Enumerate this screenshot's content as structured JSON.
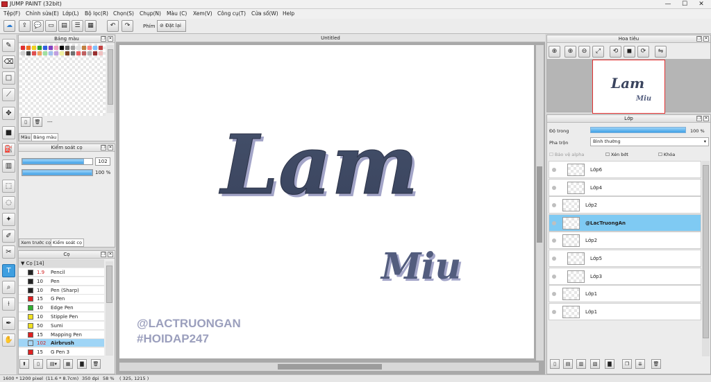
{
  "app": {
    "title": "JUMP PAINT (32bit)"
  },
  "menu": [
    "Tệp(F)",
    "Chỉnh sửa(E)",
    "Lớp(L)",
    "Bộ lọc(R)",
    "Chọn(S)",
    "Chụp(N)",
    "Màu (C)",
    "Xem(V)",
    "Công cụ(T)",
    "Cửa sổ(W)",
    "Help"
  ],
  "toolbar": {
    "phim_label": "Phím",
    "reset_label": "Đặt lại"
  },
  "canvas": {
    "tab_title": "Untitled",
    "text_main": "Lam",
    "text_sub": "Miu",
    "wm1": "@LACTRUONGAN",
    "wm2": "#HOIDAP247"
  },
  "color_panel": {
    "title": "Bảng màu",
    "dash": "---",
    "tab_colors": "Màu",
    "tab_palette": "Bảng màu",
    "swatches": [
      "#e03030",
      "#f07020",
      "#f0d020",
      "#30a030",
      "#3060e0",
      "#8040c0",
      "#f0a0c0",
      "#000000",
      "#606060",
      "#a0a0a0",
      "#e0e0e0",
      "#c08040",
      "#ff8080",
      "#80c0ff",
      "#c04040",
      "#d0d0d0",
      "#404040",
      "#e05050",
      "#f0a060",
      "#a0e0a0",
      "#a0c0f0",
      "#c0a0e0",
      "#f0f0a0",
      "#804020",
      "#707070",
      "#f06060",
      "#c06060",
      "#b0b0b0",
      "#9a3030",
      "#f0c0c0"
    ]
  },
  "brush_ctrl": {
    "title": "Kiểm soát cọ",
    "size": "102",
    "opacity": "100 %",
    "tab_preview": "Xem trước cọ",
    "tab_ctrl": "Kiểm soát cọ",
    "size_level": 0.88,
    "opacity_level": 1.0
  },
  "brush": {
    "title": "Cọ",
    "group": "Cọ [14]",
    "items": [
      {
        "size": "1.9",
        "name": "Pencil",
        "color": "#222222",
        "red": true
      },
      {
        "size": "10",
        "name": "Pen",
        "color": "#222222"
      },
      {
        "size": "10",
        "name": "Pen (Sharp)",
        "color": "#222222"
      },
      {
        "size": "15",
        "name": "G Pen",
        "color": "#e02020"
      },
      {
        "size": "10",
        "name": "Edge Pen",
        "color": "#30b030"
      },
      {
        "size": "10",
        "name": "Stipple Pen",
        "color": "#f0e020"
      },
      {
        "size": "50",
        "name": "Sumi",
        "color": "#f0e020"
      },
      {
        "size": "15",
        "name": "Mapping Pen",
        "color": "#e02020"
      },
      {
        "size": "102",
        "name": "Airbrush",
        "color": "#a8d8f8",
        "sel": true
      },
      {
        "size": "15",
        "name": "G Pen 3",
        "color": "#e02020"
      }
    ]
  },
  "navigator": {
    "title": "Hoa tiêu"
  },
  "layer": {
    "title": "Lớp",
    "opacity_label": "Độ trong",
    "opacity_value": "100 %",
    "blend_label": "Pha trộn",
    "blend_value": "Bình thường",
    "protect_alpha": "Bảo vệ alpha",
    "clipping": "Xén bớt",
    "lock": "Khóa",
    "rows": [
      {
        "name": "Lớp6"
      },
      {
        "name": "Lớp4"
      },
      {
        "name": "Lớp2"
      },
      {
        "name": "@LacTruongAn",
        "sel": true
      },
      {
        "name": "Lớp2"
      },
      {
        "name": "Lớp5"
      },
      {
        "name": "Lớp3"
      },
      {
        "name": "Lớp1"
      },
      {
        "name": "Lớp1"
      }
    ]
  },
  "status": {
    "size": "1600 * 1200 pixel",
    "cm": "(11.6 * 8.7cm)",
    "dpi": "350 dpi",
    "zoom": "58 %",
    "coords": "( 325, 1215 )"
  }
}
